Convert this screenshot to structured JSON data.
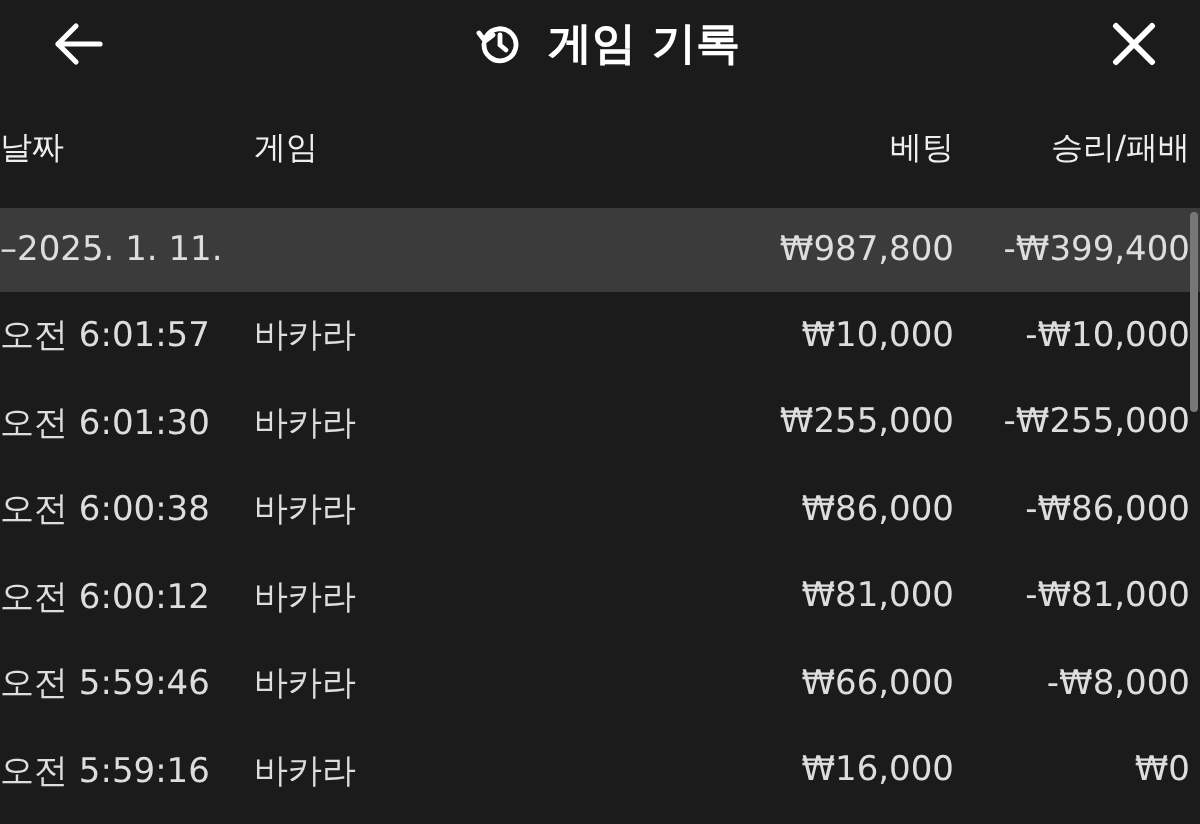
{
  "header": {
    "title": "게임 기록"
  },
  "columns": [
    "날짜",
    "게임",
    "베팅",
    "승리/패배"
  ],
  "group": {
    "date": "–2025. 1. 11.",
    "bet": "₩987,800",
    "result": "-₩399,400"
  },
  "rows": [
    {
      "time": "오전 6:01:57",
      "game": "바카라",
      "bet": "₩10,000",
      "result": "-₩10,000"
    },
    {
      "time": "오전 6:01:30",
      "game": "바카라",
      "bet": "₩255,000",
      "result": "-₩255,000"
    },
    {
      "time": "오전 6:00:38",
      "game": "바카라",
      "bet": "₩86,000",
      "result": "-₩86,000"
    },
    {
      "time": "오전 6:00:12",
      "game": "바카라",
      "bet": "₩81,000",
      "result": "-₩81,000"
    },
    {
      "time": "오전 5:59:46",
      "game": "바카라",
      "bet": "₩66,000",
      "result": "-₩8,000"
    },
    {
      "time": "오전 5:59:16",
      "game": "바카라",
      "bet": "₩16,000",
      "result": "₩0"
    }
  ]
}
